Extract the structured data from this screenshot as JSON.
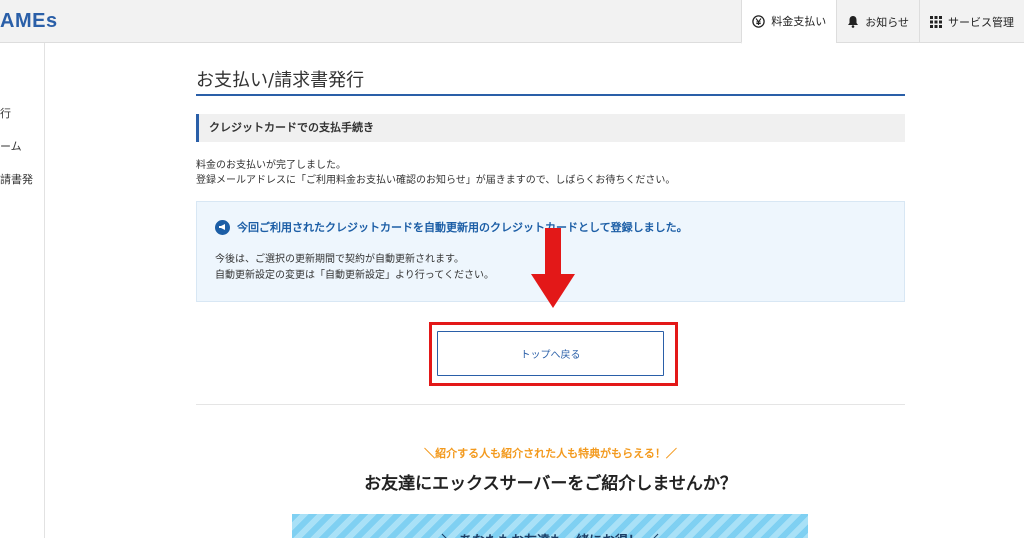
{
  "header": {
    "logo": "AMEs",
    "nav": [
      {
        "label": "料金支払い",
        "icon": "yen-icon",
        "active": true
      },
      {
        "label": "お知らせ",
        "icon": "bell-icon",
        "active": false
      },
      {
        "label": "サービス管理",
        "icon": "grid-icon",
        "active": false
      }
    ]
  },
  "sidebar": {
    "items": [
      {
        "label": "行"
      },
      {
        "label": "ーム"
      },
      {
        "label": "請書発"
      }
    ]
  },
  "main": {
    "title": "お支払い/請求書発行",
    "section_title": "クレジットカードでの支払手続き",
    "messages": [
      "料金のお支払いが完了しました。",
      "登録メールアドレスに「ご利用料金お支払い確認のお知らせ」が届きますので、しばらくお待ちください。"
    ],
    "info_box": {
      "title": "今回ご利用されたクレジットカードを自動更新用のクレジットカードとして登録しました。",
      "lines": [
        "今後は、ご選択の更新期間で契約が自動更新されます。",
        "自動更新設定の変更は「自動更新設定」より行ってください。"
      ]
    },
    "back_button": "トップへ戻る"
  },
  "promo": {
    "subtitle": "＼紹介する人も紹介された人も特典がもらえる！／",
    "title": "お友達にエックスサーバーをご紹介しませんか？",
    "banner_text": "＼ あなたもお友達も一緒にお得！ ／"
  },
  "colors": {
    "accent": "#2a5fa8",
    "highlight_frame": "#e31818",
    "promo_orange": "#f39a1e"
  }
}
